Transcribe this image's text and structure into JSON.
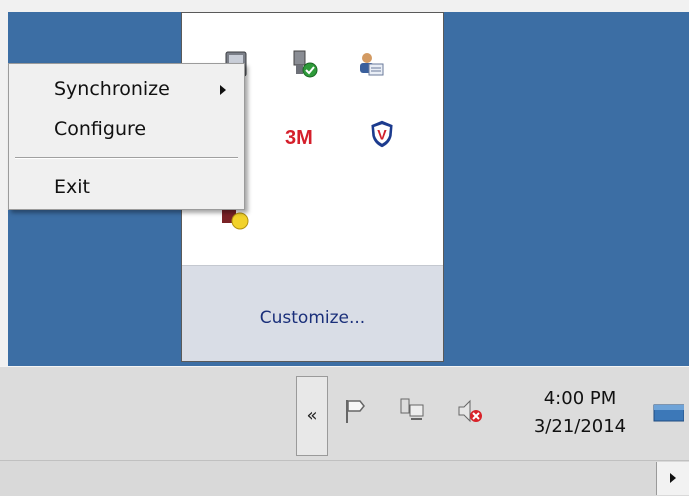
{
  "context_menu": {
    "items": [
      {
        "label": "Synchronize",
        "has_submenu": true
      },
      {
        "label": "Configure",
        "has_submenu": false
      },
      {
        "label": "Exit",
        "has_submenu": false
      }
    ]
  },
  "flyout": {
    "icons": [
      "monitor-icon",
      "safely-remove-hardware-icon",
      "user-account-icon",
      "gear-icon",
      "3m-logo-icon",
      "mcafee-shield-icon",
      "app-status-icon"
    ],
    "logo_text": "3M",
    "shield_letter": "V",
    "customize_label": "Customize..."
  },
  "taskbar": {
    "show_hidden_label": "«",
    "clock": {
      "time": "4:00 PM",
      "date": "3/21/2014"
    },
    "tray_icons": [
      "action-center-flag-icon",
      "network-icon",
      "volume-muted-icon"
    ]
  },
  "colors": {
    "desktop": "#3c6ea4",
    "taskbar": "#dcdcdc",
    "link": "#1a2f7a",
    "menu_bg": "#f0f0f0"
  }
}
